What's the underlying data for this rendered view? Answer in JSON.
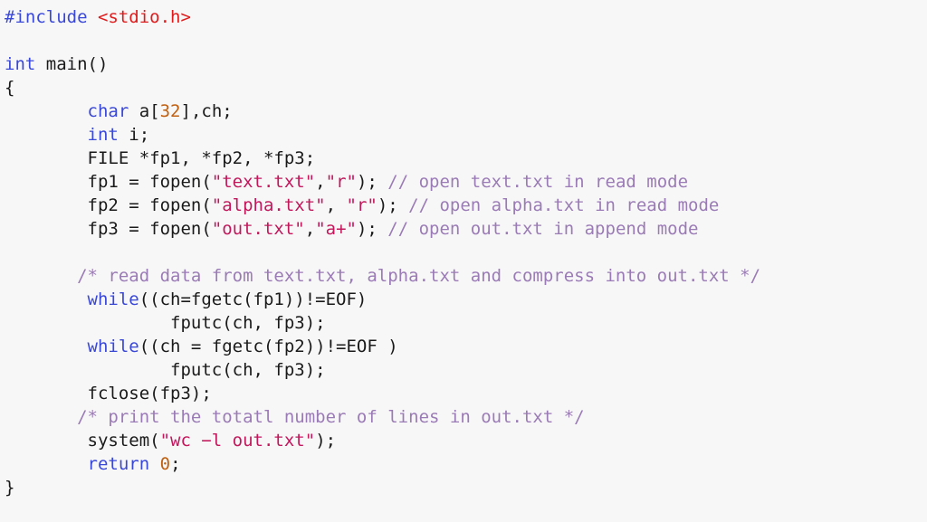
{
  "editor": {
    "language": "c",
    "background_color": "#f7f7f8",
    "colors": {
      "keyword": "#3a48d8",
      "preprocessor": "#3a48d8",
      "header": "#e01b1b",
      "string": "#c2185b",
      "number": "#c06010",
      "comment": "#9b7bb5",
      "plain": "#1a1a1a"
    }
  },
  "code": {
    "lines": [
      {
        "id": "line-1",
        "tokens": [
          {
            "t": "#include ",
            "c": "pre"
          },
          {
            "t": "<stdio.h>",
            "c": "hdr"
          }
        ]
      },
      {
        "id": "line-2",
        "tokens": []
      },
      {
        "id": "line-3",
        "tokens": [
          {
            "t": "int",
            "c": "kw"
          },
          {
            "t": " main()",
            "c": "pln"
          }
        ]
      },
      {
        "id": "line-4",
        "tokens": [
          {
            "t": "{",
            "c": "pln"
          }
        ]
      },
      {
        "id": "line-5",
        "tokens": [
          {
            "t": "        ",
            "c": "pln"
          },
          {
            "t": "char",
            "c": "kw"
          },
          {
            "t": " a[",
            "c": "pln"
          },
          {
            "t": "32",
            "c": "num"
          },
          {
            "t": "],ch;",
            "c": "pln"
          }
        ]
      },
      {
        "id": "line-6",
        "tokens": [
          {
            "t": "        ",
            "c": "pln"
          },
          {
            "t": "int",
            "c": "kw"
          },
          {
            "t": " i;",
            "c": "pln"
          }
        ]
      },
      {
        "id": "line-7",
        "tokens": [
          {
            "t": "        FILE *fp1, *fp2, *fp3;",
            "c": "pln"
          }
        ]
      },
      {
        "id": "line-8",
        "tokens": [
          {
            "t": "        fp1 = fopen(",
            "c": "pln"
          },
          {
            "t": "\"text.txt\"",
            "c": "str"
          },
          {
            "t": ",",
            "c": "pln"
          },
          {
            "t": "\"r\"",
            "c": "str"
          },
          {
            "t": "); ",
            "c": "pln"
          },
          {
            "t": "// open text.txt in read mode",
            "c": "com"
          }
        ]
      },
      {
        "id": "line-9",
        "tokens": [
          {
            "t": "        fp2 = fopen(",
            "c": "pln"
          },
          {
            "t": "\"alpha.txt\"",
            "c": "str"
          },
          {
            "t": ", ",
            "c": "pln"
          },
          {
            "t": "\"r\"",
            "c": "str"
          },
          {
            "t": "); ",
            "c": "pln"
          },
          {
            "t": "// open alpha.txt in read mode",
            "c": "com"
          }
        ]
      },
      {
        "id": "line-10",
        "tokens": [
          {
            "t": "        fp3 = fopen(",
            "c": "pln"
          },
          {
            "t": "\"out.txt\"",
            "c": "str"
          },
          {
            "t": ",",
            "c": "pln"
          },
          {
            "t": "\"a+\"",
            "c": "str"
          },
          {
            "t": "); ",
            "c": "pln"
          },
          {
            "t": "// open out.txt in append mode",
            "c": "com"
          }
        ]
      },
      {
        "id": "line-11",
        "tokens": []
      },
      {
        "id": "line-12",
        "tokens": [
          {
            "t": "       ",
            "c": "pln"
          },
          {
            "t": "/* read data from text.txt, alpha.txt and compress into out.txt */",
            "c": "com"
          }
        ]
      },
      {
        "id": "line-13",
        "tokens": [
          {
            "t": "        ",
            "c": "pln"
          },
          {
            "t": "while",
            "c": "kw"
          },
          {
            "t": "((ch=fgetc(fp1))!=EOF)",
            "c": "pln"
          }
        ]
      },
      {
        "id": "line-14",
        "tokens": [
          {
            "t": "                fputc(ch, fp3);",
            "c": "pln"
          }
        ]
      },
      {
        "id": "line-15",
        "tokens": [
          {
            "t": "        ",
            "c": "pln"
          },
          {
            "t": "while",
            "c": "kw"
          },
          {
            "t": "((ch = fgetc(fp2))!=EOF )",
            "c": "pln"
          }
        ]
      },
      {
        "id": "line-16",
        "tokens": [
          {
            "t": "                fputc(ch, fp3);",
            "c": "pln"
          }
        ]
      },
      {
        "id": "line-17",
        "tokens": [
          {
            "t": "        fclose(fp3);",
            "c": "pln"
          }
        ]
      },
      {
        "id": "line-18",
        "tokens": [
          {
            "t": "       ",
            "c": "pln"
          },
          {
            "t": "/* print the totatl number of lines in out.txt */",
            "c": "com"
          }
        ]
      },
      {
        "id": "line-19",
        "tokens": [
          {
            "t": "        system(",
            "c": "pln"
          },
          {
            "t": "\"wc −l out.txt\"",
            "c": "str"
          },
          {
            "t": ");",
            "c": "pln"
          }
        ]
      },
      {
        "id": "line-20",
        "tokens": [
          {
            "t": "        ",
            "c": "pln"
          },
          {
            "t": "return",
            "c": "kw"
          },
          {
            "t": " ",
            "c": "pln"
          },
          {
            "t": "0",
            "c": "num"
          },
          {
            "t": ";",
            "c": "pln"
          }
        ]
      },
      {
        "id": "line-21",
        "tokens": [
          {
            "t": "}",
            "c": "pln"
          }
        ]
      }
    ]
  }
}
